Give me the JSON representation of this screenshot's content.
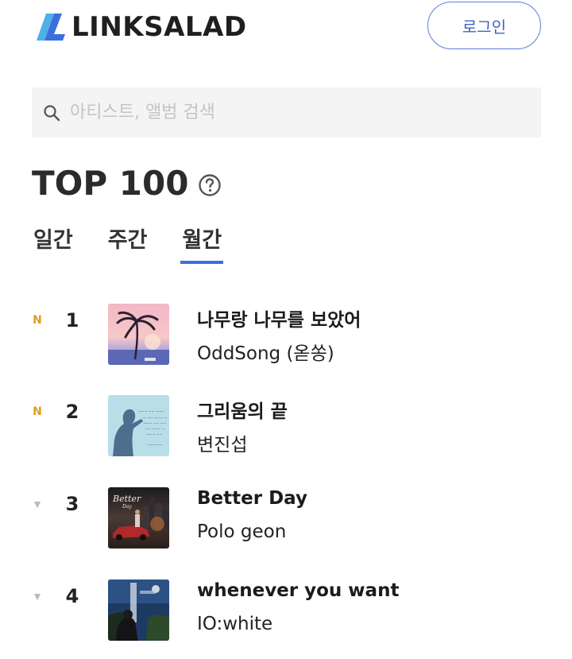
{
  "header": {
    "brand": "LINKSALAD",
    "brand_colors": {
      "primary": "#3c6fdc",
      "secondary": "#4fb0e8"
    },
    "login_label": "로그인"
  },
  "search": {
    "placeholder": "아티스트, 앨범 검색",
    "value": ""
  },
  "chart_header": {
    "title": "TOP 100",
    "help_icon": "question-circle-icon"
  },
  "tabs": [
    {
      "label": "일간",
      "active": false
    },
    {
      "label": "주간",
      "active": false
    },
    {
      "label": "월간",
      "active": true
    }
  ],
  "accent_color": "#3c6fdc",
  "chart": [
    {
      "rank": "1",
      "change": "N",
      "change_type": "new",
      "title": "나무랑 나무를 보았어",
      "artist": "OddSong (옫쏭)",
      "cover": "palm-tree-sunset"
    },
    {
      "rank": "2",
      "change": "▼",
      "change_type": "none",
      "title": "그리움의 끝",
      "artist": "변진섭",
      "cover": "singer-silhouette-blue"
    },
    {
      "rank": "3",
      "change": "▼",
      "change_type": "down",
      "title": "Better Day",
      "artist": "Polo geon",
      "cover": "city-car-night"
    },
    {
      "rank": "4",
      "change": "▼",
      "change_type": "down",
      "title": "whenever you want",
      "artist": "IO:white",
      "cover": "night-sky-figure"
    }
  ]
}
